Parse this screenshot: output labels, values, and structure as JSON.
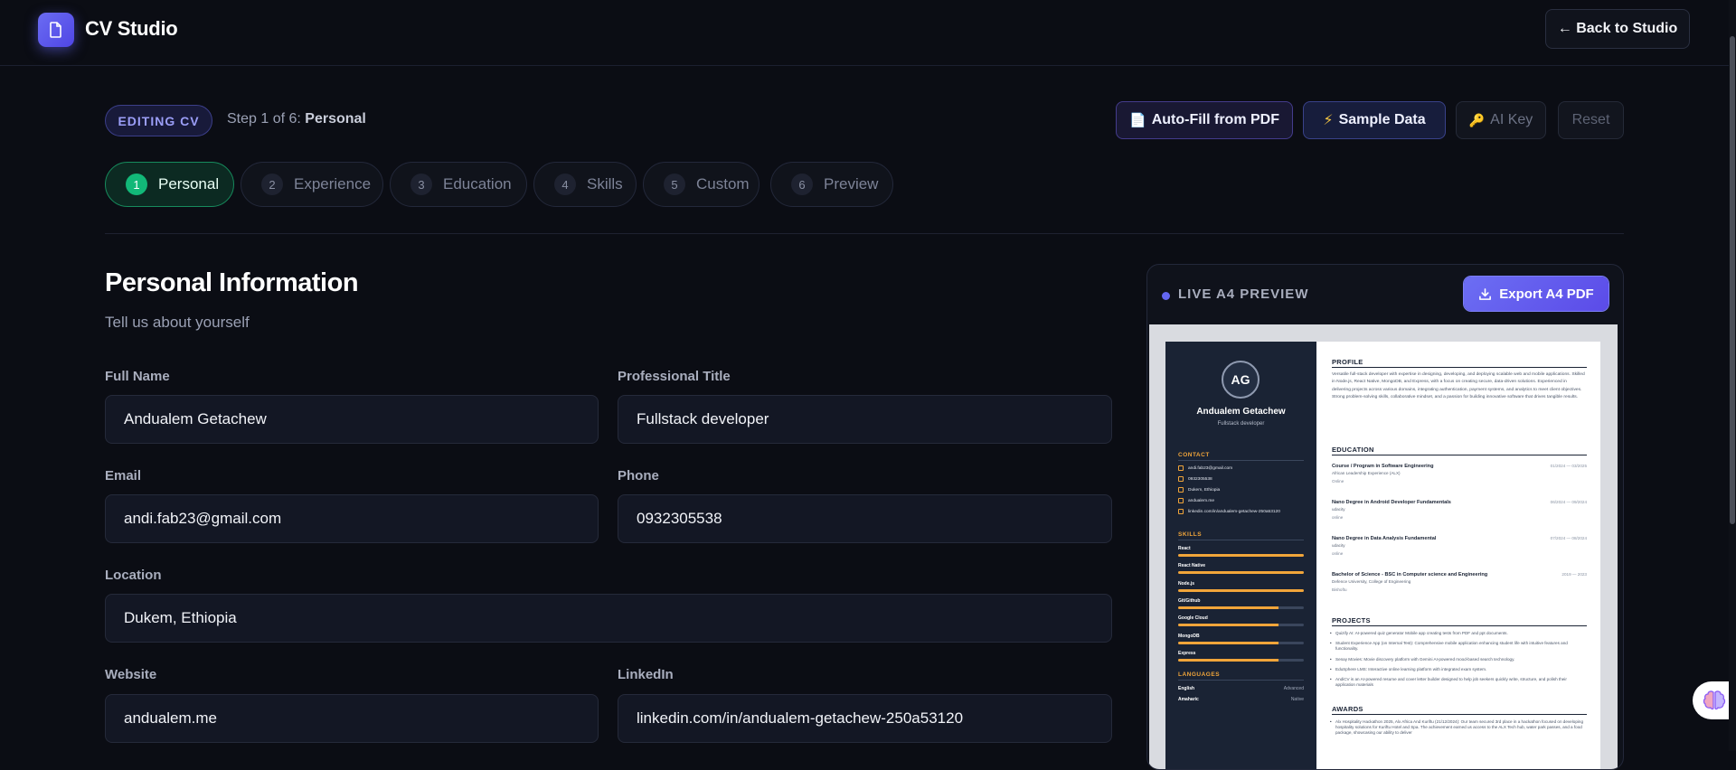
{
  "app": {
    "title": "CV Studio",
    "back_label": "← Back to Studio"
  },
  "header": {
    "badge": "EDITING CV",
    "step_prefix": "Step 1 of 6: ",
    "step_current": "Personal",
    "actions": {
      "autofill": "Auto-Fill from PDF",
      "sample": "Sample Data",
      "ai_key": "AI Key",
      "reset": "Reset"
    }
  },
  "steps": [
    {
      "num": "1",
      "label": "Personal",
      "active": true
    },
    {
      "num": "2",
      "label": "Experience"
    },
    {
      "num": "3",
      "label": "Education"
    },
    {
      "num": "4",
      "label": "Skills"
    },
    {
      "num": "5",
      "label": "Custom"
    },
    {
      "num": "6",
      "label": "Preview"
    }
  ],
  "form": {
    "title": "Personal Information",
    "subtitle": "Tell us about yourself",
    "full_name": {
      "label": "Full Name",
      "value": "Andualem Getachew"
    },
    "title_field": {
      "label": "Professional Title",
      "value": "Fullstack developer"
    },
    "email": {
      "label": "Email",
      "value": "andi.fab23@gmail.com"
    },
    "phone": {
      "label": "Phone",
      "value": "0932305538"
    },
    "location": {
      "label": "Location",
      "value": "Dukem, Ethiopia"
    },
    "website": {
      "label": "Website",
      "value": "andualem.me"
    },
    "linkedin": {
      "label": "LinkedIn",
      "value": "linkedin.com/in/andualem-getachew-250a53120"
    }
  },
  "preview": {
    "label": "LIVE A4 PREVIEW",
    "export_label": "Export A4 PDF",
    "cv": {
      "initials": "AG",
      "name": "Andualem Getachew",
      "role": "Fullstack developer",
      "contact_heading": "CONTACT",
      "contacts": [
        "andi.fab23@gmail.com",
        "0932305538",
        "Dukem, Ethiopia",
        "andualem.me",
        "linkedin.com/in/andualem-getachew-250a53120"
      ],
      "skills_heading": "SKILLS",
      "skills": [
        {
          "name": "React",
          "level": 1.0
        },
        {
          "name": "React Native",
          "level": 1.0
        },
        {
          "name": "Node.js",
          "level": 1.0
        },
        {
          "name": "Git/Github",
          "level": 0.8
        },
        {
          "name": "Google Cloud",
          "level": 0.8
        },
        {
          "name": "MongoDB",
          "level": 0.8
        },
        {
          "name": "Express",
          "level": 0.8
        }
      ],
      "languages_heading": "LANGUAGES",
      "languages": [
        {
          "name": "English",
          "level": "Advanced"
        },
        {
          "name": "Amaharic",
          "level": "Native"
        }
      ],
      "profile_heading": "PROFILE",
      "profile_text": "Versatile full-stack developer with expertise in designing, developing, and deploying scalable web and mobile applications. Skilled in Node.js, React Native, MongoDB, and Express, with a focus on creating secure, data-driven solutions. Experienced in delivering projects across various domains, integrating authentication, payment systems, and analytics to meet client objectives. Strong problem-solving skills, collaborative mindset, and a passion for building innovative software that drives tangible results.",
      "education_heading": "EDUCATION",
      "education": [
        {
          "title": "Course / Program in Software Engineering",
          "school": "African Leadership Experience (ALX)",
          "mode": "Online",
          "date": "01/2024 — 03/2025"
        },
        {
          "title": "Nano Degree in Android Developer Fundamentals",
          "school": "udacity",
          "mode": "online",
          "date": "06/2024 — 09/2024"
        },
        {
          "title": "Nano Degree in Data Analysis Fundamental",
          "school": "udacity",
          "mode": "online",
          "date": "07/2024 — 08/2024"
        },
        {
          "title": "Bachelor of Science - BSC in Computer science and Engineering",
          "school": "Defence University, College of Engineering",
          "mode": "Bishoftu",
          "date": "2019 — 2023"
        }
      ],
      "projects_heading": "PROJECTS",
      "projects": [
        "Quizify AI: AI-powered quiz generator Mobile app creating tests from PDF and ppt documents.",
        "Student Experience App (on Internal Test): Comprehensive mobile application enhancing student life with intuitive features and functionality.",
        "Senay Movies: Movie discovery platform with Gemini AI-powered mood-based search technology.",
        "EduSphere LMS: Interactive online learning platform with integrated exam system.",
        "AndiCV is an AI-powered resume and cover letter builder designed to help job seekers quickly write, structure, and polish their application materials"
      ],
      "awards_heading": "AWARDS",
      "awards_text": "Alx Hospitality Hackathon 2025, Alx Africa And Kuriftu (21/12/2024): Our team secured 3rd place in a hackathon focused on developing hospitality solutions for Kuriftu Hotel and Spa. The achievement earned us access to the ALX Tech hub, water park passes, and a food package, showcasing our ability to deliver"
    }
  },
  "colors": {
    "accent": "#6366f1",
    "active_step": "#12b878",
    "cv_sidebar": "#1a2334",
    "cv_highlight": "#f1a53a"
  }
}
